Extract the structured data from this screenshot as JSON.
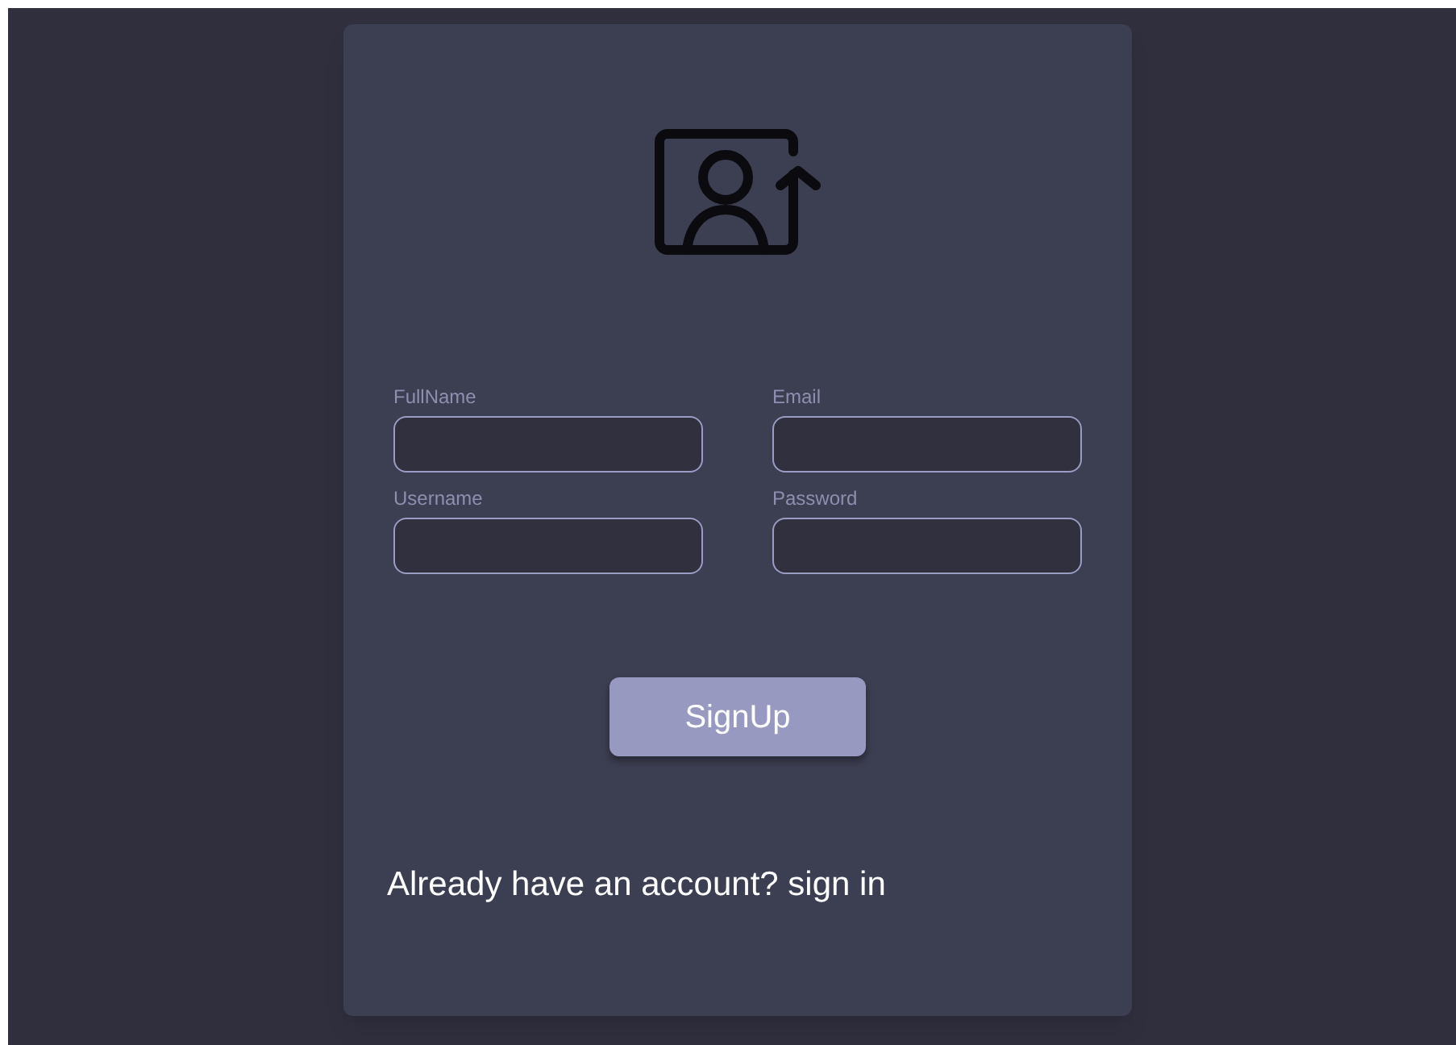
{
  "fields": [
    {
      "label": "FullName"
    },
    {
      "label": "Email"
    },
    {
      "label": "Username"
    },
    {
      "label": "Password"
    }
  ],
  "submit_button": "SignUp",
  "footer_text": "Already have an account? sign in"
}
